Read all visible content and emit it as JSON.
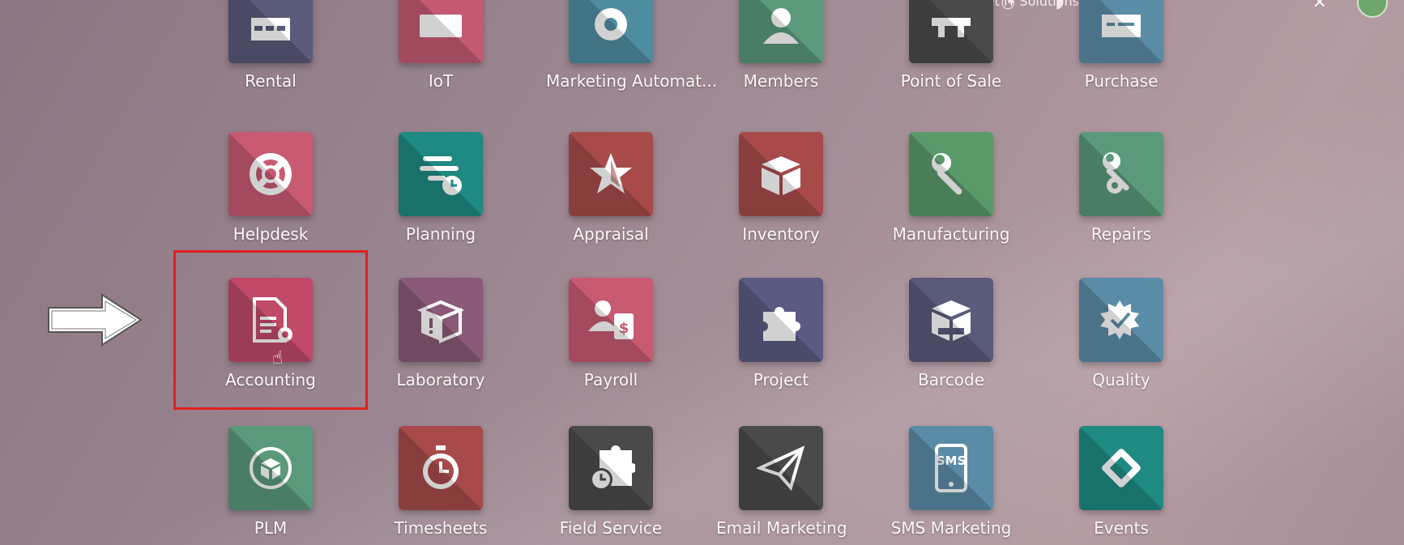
{
  "topbar": {
    "company": "Caret IT Solutions Pvt. Ltd.",
    "close_icon": "×"
  },
  "apps": {
    "row0": [
      {
        "label": "Rental",
        "color": "#5a5a7a",
        "icon": "rental-icon"
      },
      {
        "label": "IoT",
        "color": "#c45a72",
        "icon": "iot-icon"
      },
      {
        "label": "Marketing Automat...",
        "color": "#4e8ca0",
        "icon": "marketing-automation-icon"
      },
      {
        "label": "Members",
        "color": "#5a9a7a",
        "icon": "members-icon"
      },
      {
        "label": "Point of Sale",
        "color": "#4a4a4a",
        "icon": "point-of-sale-icon"
      },
      {
        "label": "Purchase",
        "color": "#5a8ca8",
        "icon": "purchase-icon"
      }
    ],
    "row1": [
      {
        "label": "Helpdesk",
        "color": "#c85a72",
        "icon": "helpdesk-icon"
      },
      {
        "label": "Planning",
        "color": "#1e8a82",
        "icon": "planning-icon"
      },
      {
        "label": "Appraisal",
        "color": "#a84a4a",
        "icon": "appraisal-icon"
      },
      {
        "label": "Inventory",
        "color": "#a84a4a",
        "icon": "inventory-icon"
      },
      {
        "label": "Manufacturing",
        "color": "#5a9a6a",
        "icon": "manufacturing-icon"
      },
      {
        "label": "Repairs",
        "color": "#5a9a7a",
        "icon": "repairs-icon"
      }
    ],
    "row2": [
      {
        "label": "Accounting",
        "color": "#c04a68",
        "icon": "accounting-icon"
      },
      {
        "label": "Laboratory",
        "color": "#8a5a78",
        "icon": "laboratory-icon"
      },
      {
        "label": "Payroll",
        "color": "#c85a72",
        "icon": "payroll-icon"
      },
      {
        "label": "Project",
        "color": "#5a5a82",
        "icon": "project-icon"
      },
      {
        "label": "Barcode",
        "color": "#5a5a7a",
        "icon": "barcode-icon"
      },
      {
        "label": "Quality",
        "color": "#5a8ca8",
        "icon": "quality-icon"
      }
    ],
    "row3": [
      {
        "label": "PLM",
        "color": "#5a9a7a",
        "icon": "plm-icon"
      },
      {
        "label": "Timesheets",
        "color": "#a84a4a",
        "icon": "timesheets-icon"
      },
      {
        "label": "Field Service",
        "color": "#4a4a4a",
        "icon": "field-service-icon"
      },
      {
        "label": "Email Marketing",
        "color": "#4a4a4a",
        "icon": "email-marketing-icon"
      },
      {
        "label": "SMS Marketing",
        "color": "#5a8ca8",
        "icon": "sms-marketing-icon"
      },
      {
        "label": "Events",
        "color": "#1e8a82",
        "icon": "events-icon"
      }
    ]
  },
  "sms_glyph_text": "SMS",
  "payroll_glyph_text": "$"
}
